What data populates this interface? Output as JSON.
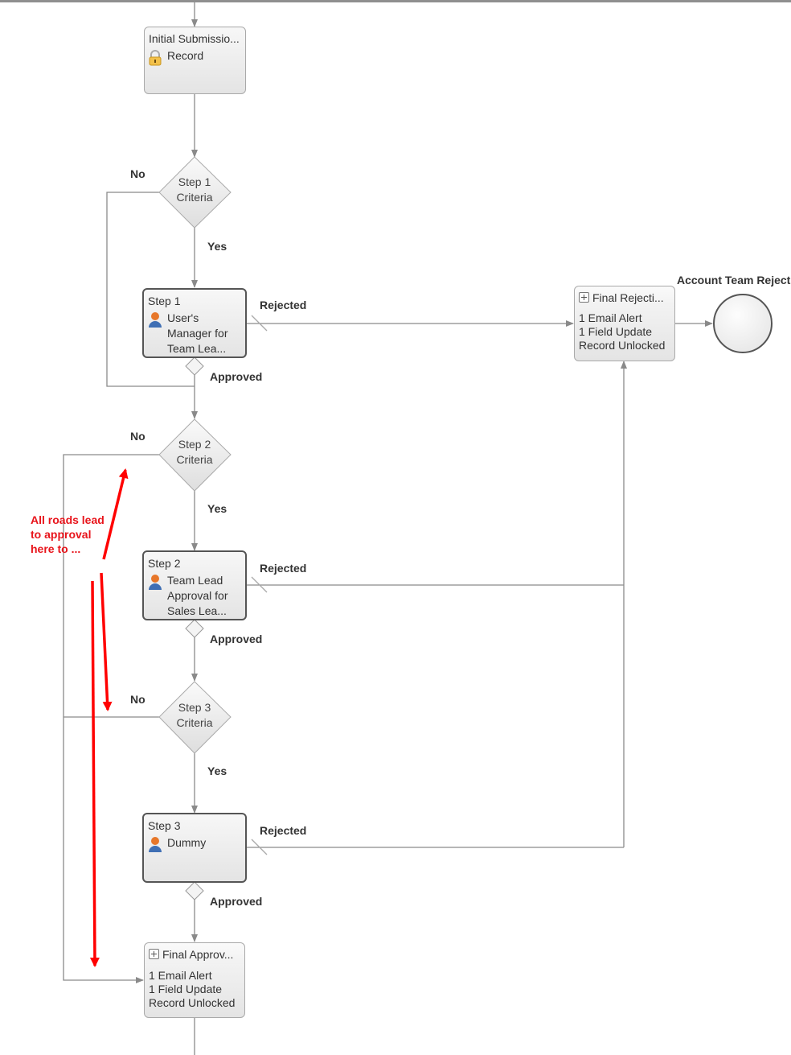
{
  "diagram": {
    "initial_submission": {
      "title": "Initial Submissio...",
      "actions": [
        "Record"
      ],
      "icon": "lock-icon"
    },
    "criteria": [
      {
        "line1": "Step 1",
        "line2": "Criteria",
        "no_label": "No",
        "yes_label": "Yes"
      },
      {
        "line1": "Step 2",
        "line2": "Criteria",
        "no_label": "No",
        "yes_label": "Yes"
      },
      {
        "line1": "Step 3",
        "line2": "Criteria",
        "no_label": "No",
        "yes_label": "Yes"
      }
    ],
    "steps": [
      {
        "title": "Step 1",
        "approver": [
          "User's",
          "Manager for",
          "Team Lea..."
        ],
        "icon": "user-icon",
        "rejected_label": "Rejected",
        "approved_label": "Approved"
      },
      {
        "title": "Step 2",
        "approver": [
          "Team Lead",
          "Approval for",
          "Sales Lea..."
        ],
        "icon": "user-icon",
        "rejected_label": "Rejected",
        "approved_label": "Approved"
      },
      {
        "title": "Step 3",
        "approver": [
          "Dummy"
        ],
        "icon": "user-icon",
        "rejected_label": "Rejected",
        "approved_label": "Approved"
      }
    ],
    "final_rejection": {
      "title": "Final Rejecti...",
      "actions": [
        "1 Email Alert",
        "1 Field Update",
        "Record Unlocked"
      ],
      "icon": "expand-plus-icon"
    },
    "final_approval": {
      "title": "Final Approv...",
      "actions": [
        "1 Email Alert",
        "1 Field Update",
        "Record Unlocked"
      ],
      "icon": "expand-plus-icon"
    },
    "end_state": {
      "label": "Account Team Reject"
    },
    "annotation": {
      "lines": [
        "All roads lead",
        "to approval",
        "here to ..."
      ],
      "color": "#e8141b"
    },
    "colors": {
      "connector": "#8a8a8a",
      "node_border": "#555555"
    }
  }
}
